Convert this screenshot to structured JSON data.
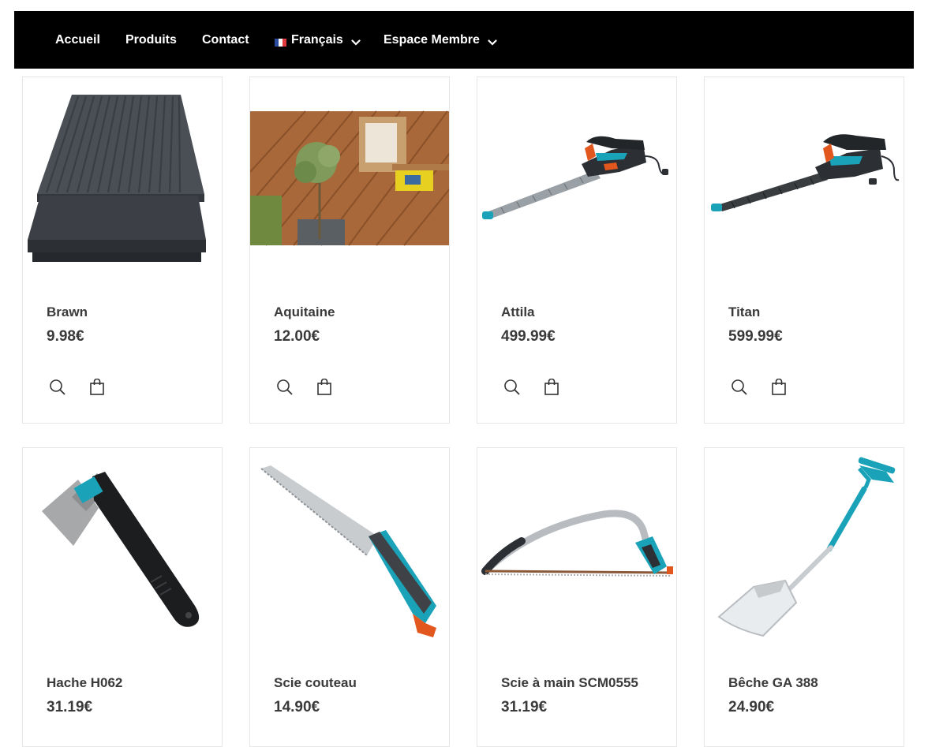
{
  "nav": {
    "items": [
      {
        "label": "Accueil"
      },
      {
        "label": "Produits"
      },
      {
        "label": "Contact"
      },
      {
        "label": "Français",
        "icon": "france-flag-icon",
        "dropdown": true
      },
      {
        "label": "Espace Membre",
        "dropdown": true
      }
    ]
  },
  "products": [
    {
      "name": "Brawn",
      "price": "9.98€"
    },
    {
      "name": "Aquitaine",
      "price": "12.00€"
    },
    {
      "name": "Attila",
      "price": "499.99€"
    },
    {
      "name": "Titan",
      "price": "599.99€"
    },
    {
      "name": "Hache H062",
      "price": "31.19€"
    },
    {
      "name": "Scie couteau",
      "price": "14.90€"
    },
    {
      "name": "Scie à main SCM0555",
      "price": "31.19€"
    },
    {
      "name": "Bêche GA 388",
      "price": "24.90€"
    }
  ],
  "colors": {
    "navbar": "#000000",
    "text": "#3a3a3a",
    "accent_teal": "#1aa3b8",
    "accent_orange": "#e2571e"
  }
}
